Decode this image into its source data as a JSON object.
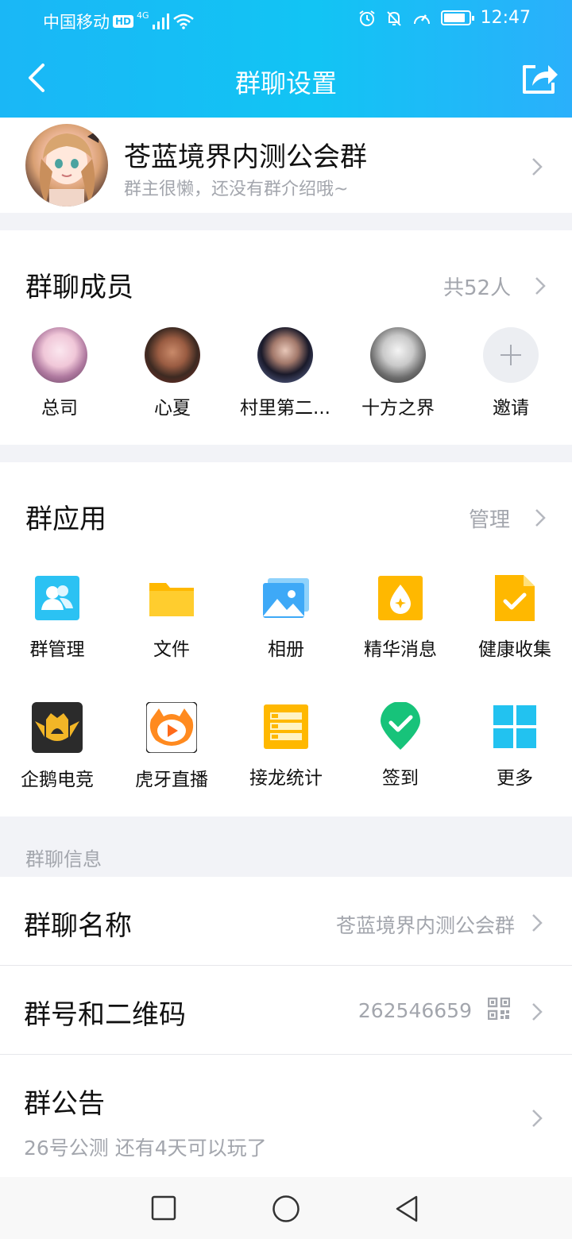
{
  "status": {
    "carrier": "中国移动",
    "hd": "HD",
    "network": "4G",
    "time": "12:47"
  },
  "nav": {
    "title": "群聊设置"
  },
  "group": {
    "name": "苍蓝境界内测公会群",
    "intro": "群主很懒，还没有群介绍哦~"
  },
  "members": {
    "title": "群聊成员",
    "count": "共52人",
    "list": [
      {
        "name": "总司"
      },
      {
        "name": "心夏"
      },
      {
        "name": "村里第二..."
      },
      {
        "name": "十方之界"
      },
      {
        "name": "邀请"
      }
    ]
  },
  "apps": {
    "title": "群应用",
    "manage": "管理",
    "items": [
      {
        "label": "群管理",
        "icon": "group-manage-icon"
      },
      {
        "label": "文件",
        "icon": "folder-icon"
      },
      {
        "label": "相册",
        "icon": "photo-album-icon"
      },
      {
        "label": "精华消息",
        "icon": "essence-message-icon"
      },
      {
        "label": "健康收集",
        "icon": "health-collect-icon"
      },
      {
        "label": "企鹅电竞",
        "icon": "penguin-esports-icon"
      },
      {
        "label": "虎牙直播",
        "icon": "huya-live-icon"
      },
      {
        "label": "接龙统计",
        "icon": "solitaire-stats-icon"
      },
      {
        "label": "签到",
        "icon": "check-in-icon"
      },
      {
        "label": "更多",
        "icon": "more-apps-icon"
      }
    ]
  },
  "info": {
    "section_label": "群聊信息",
    "name_label": "群聊名称",
    "name_value": "苍蓝境界内测公会群",
    "id_label": "群号和二维码",
    "id_value": "262546659",
    "notice_label": "群公告",
    "notice_value": "26号公测 还有4天可以玩了"
  },
  "colors": {
    "header": "#1ab7f6",
    "accent": "#12b7f5",
    "muted": "#a3a6ad"
  }
}
